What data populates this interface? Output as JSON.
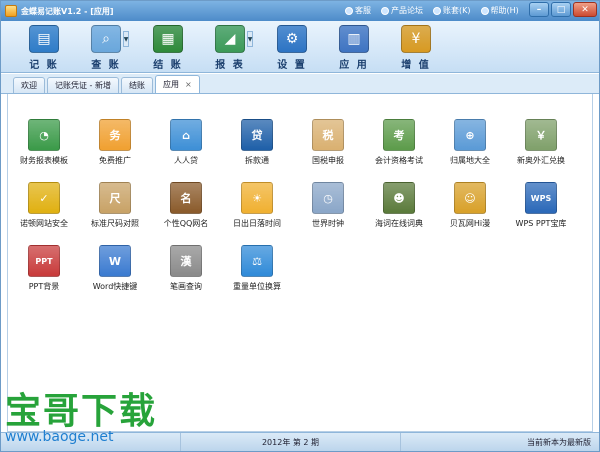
{
  "window": {
    "title": "金蝶易记账V1.2 - [应用]"
  },
  "top_links": [
    {
      "label": "客服"
    },
    {
      "label": "产品论坛"
    },
    {
      "label": "账套(K)"
    },
    {
      "label": "帮助(H)"
    }
  ],
  "window_buttons": {
    "minimize": "–",
    "maximize": "□",
    "close": "✕"
  },
  "toolbar": {
    "items": [
      {
        "label": "记 账",
        "icon": "ledger-icon",
        "color": "#2f7cc8"
      },
      {
        "label": "查 账",
        "icon": "magnifier-icon",
        "color": "#6aa7dc"
      },
      {
        "label": "结 账",
        "icon": "calendar-icon",
        "color": "#2f8a3a"
      },
      {
        "label": "报 表",
        "icon": "chart-icon",
        "color": "#3c9a58"
      },
      {
        "label": "设 置",
        "icon": "gear-icon",
        "color": "#2d74c4"
      },
      {
        "label": "应 用",
        "icon": "apps-icon",
        "color": "#3f74c2"
      },
      {
        "label": "增 值",
        "icon": "coin-icon",
        "color": "#d89a22"
      }
    ],
    "drop_arrow": "▼"
  },
  "tabs": [
    {
      "label": "欢迎"
    },
    {
      "label": "记账凭证 - 新增"
    },
    {
      "label": "结账"
    },
    {
      "label": "应用",
      "close": "×"
    }
  ],
  "apps": [
    {
      "label": "财务报表模板",
      "icon": "pie-chart-icon",
      "glyph": "◔",
      "color": "#3a9a48"
    },
    {
      "label": "免费推广",
      "icon": "promo-icon",
      "glyph": "务",
      "color": "#f0a030"
    },
    {
      "label": "人人贷",
      "icon": "rrd-icon",
      "glyph": "⌂",
      "color": "#3d8fd6"
    },
    {
      "label": "拆款通",
      "icon": "loan-icon",
      "glyph": "贷",
      "color": "#1e5fa8"
    },
    {
      "label": "国税申报",
      "icon": "tax-icon",
      "glyph": "税",
      "color": "#d9b070"
    },
    {
      "label": "会计资格考试",
      "icon": "exam-icon",
      "glyph": "考",
      "color": "#5c9b4a"
    },
    {
      "label": "归属地大全",
      "icon": "search-globe-icon",
      "glyph": "⊕",
      "color": "#5a9ad6"
    },
    {
      "label": "新奥外汇兑换",
      "icon": "exchange-icon",
      "glyph": "￥",
      "color": "#7fa06a"
    },
    {
      "label": "诺顿网站安全",
      "icon": "norton-icon",
      "glyph": "✓",
      "color": "#e0b010"
    },
    {
      "label": "标准尺码对照",
      "icon": "size-icon",
      "glyph": "尺",
      "color": "#c8a266"
    },
    {
      "label": "个性QQ网名",
      "icon": "qq-icon",
      "glyph": "名",
      "color": "#8a5a2a"
    },
    {
      "label": "日出日落时间",
      "icon": "sunrise-icon",
      "glyph": "☀",
      "color": "#f0b030"
    },
    {
      "label": "世界时钟",
      "icon": "clock-icon",
      "glyph": "◷",
      "color": "#8aa6c8"
    },
    {
      "label": "海词在线词典",
      "icon": "dictionary-icon",
      "glyph": "☻",
      "color": "#5a7a3a"
    },
    {
      "label": "贝瓦网Hi漫",
      "icon": "cartoon-icon",
      "glyph": "☺",
      "color": "#d8a028"
    },
    {
      "label": "WPS PPT宝库",
      "icon": "wps-icon",
      "glyph": "WPS",
      "color": "#2a68b8"
    },
    {
      "label": "PPT背景",
      "icon": "ppt-icon",
      "glyph": "PPT",
      "color": "#c83a3a"
    },
    {
      "label": "Word快捷键",
      "icon": "word-icon",
      "glyph": "W",
      "color": "#3a7ad0"
    },
    {
      "label": "笔画查询",
      "icon": "stroke-icon",
      "glyph": "漢",
      "color": "#8a8a8a"
    },
    {
      "label": "重量单位换算",
      "icon": "scale-icon",
      "glyph": "⚖",
      "color": "#2f8ad8"
    }
  ],
  "status": {
    "period": "2012年 第 2 期",
    "version": "当前新本为最新版"
  },
  "watermark": {
    "text": "宝哥下载",
    "url": "www.baoge.net"
  }
}
